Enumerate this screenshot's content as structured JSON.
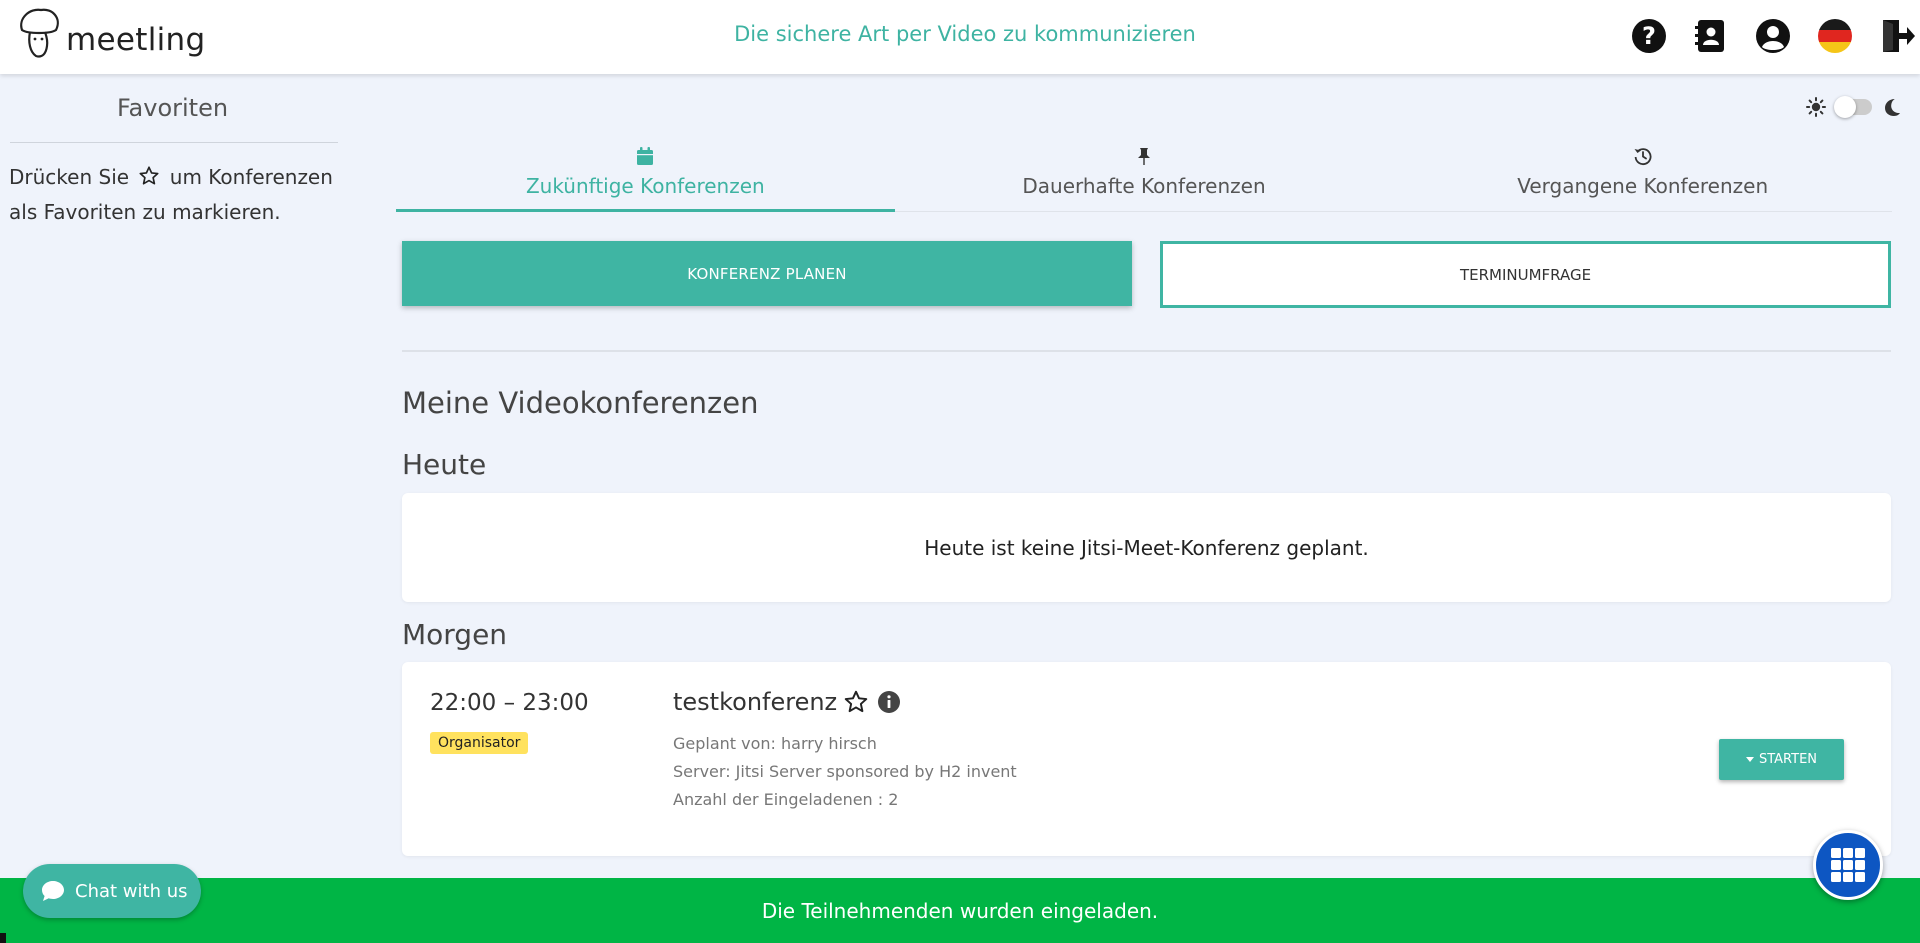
{
  "header": {
    "logo_text": "meetling",
    "tagline": "Die sichere Art per Video zu kommunizieren",
    "icons": [
      "help-icon",
      "contacts-icon",
      "account-icon",
      "german-flag-icon",
      "logout-icon"
    ]
  },
  "sidebar": {
    "title": "Favoriten",
    "hint_before": "Drücken Sie",
    "hint_after": "um Konferenzen als Favoriten zu markieren."
  },
  "theme_toggle": {
    "dark_mode": false
  },
  "tabs": [
    {
      "label": "Zukünftige Konferenzen",
      "icon": "calendar-icon",
      "active": true
    },
    {
      "label": "Dauerhafte Konferenzen",
      "icon": "pin-icon",
      "active": false
    },
    {
      "label": "Vergangene Konferenzen",
      "icon": "history-icon",
      "active": false
    }
  ],
  "actions": {
    "plan": "KONFERENZ PLANEN",
    "poll": "TERMINUMFRAGE"
  },
  "main": {
    "section_title": "Meine Videokonferenzen",
    "today": {
      "heading": "Heute",
      "empty_text": "Heute ist keine Jitsi-Meet-Konferenz geplant."
    },
    "tomorrow": {
      "heading": "Morgen",
      "conference": {
        "time": "22:00 – 23:00",
        "role_badge": "Organisator",
        "title": "testkonferenz",
        "planned_by": "Geplant von: harry hirsch",
        "server": "Server: Jitsi Server sponsored by H2 invent",
        "invitees": "Anzahl der Eingeladenen : 2",
        "start_label": "STARTEN"
      }
    }
  },
  "notice": "Die Teilnehmenden wurden eingeladen.",
  "chat": {
    "label": "Chat with us"
  },
  "colors": {
    "accent": "#3fb5a3",
    "notice_bg": "#00b545",
    "badge_bg": "#ffe25e",
    "apps_button": "#0d56c2",
    "page_bg": "#eff3fb"
  }
}
